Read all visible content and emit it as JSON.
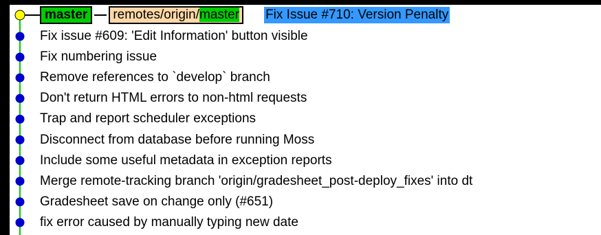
{
  "window": {
    "background": "#000000",
    "panel_background": "#ffffff"
  },
  "graph": {
    "line_color": "#00cc00",
    "head_node_color": "#ffff00",
    "commit_node_color": "#0000cc"
  },
  "head": {
    "local_branch": "master",
    "remote_prefix": "remotes/origin/",
    "remote_branch": "master",
    "message": "Fix Issue #710: Version Penalty",
    "selected": true,
    "selection_color": "#3399ff"
  },
  "commits": [
    {
      "message": "Fix issue #609: 'Edit Information' button visible"
    },
    {
      "message": "Fix numbering issue"
    },
    {
      "message": "Remove references to `develop` branch"
    },
    {
      "message": "Don't return HTML errors to non-html requests"
    },
    {
      "message": "Trap and report scheduler exceptions"
    },
    {
      "message": "Disconnect from database before running Moss"
    },
    {
      "message": "Include some useful metadata in exception reports"
    },
    {
      "message": "Merge remote-tracking branch 'origin/gradesheet_post-deploy_fixes' into dt"
    },
    {
      "message": "Gradesheet save on change only (#651)"
    },
    {
      "message": "fix error caused by manually typing new date"
    }
  ]
}
